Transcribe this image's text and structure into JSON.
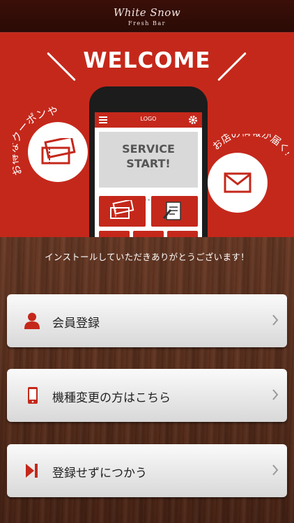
{
  "header": {
    "brand_script": "White Snow",
    "brand_sub": "Fresh Bar"
  },
  "hero": {
    "title": "WELCOME",
    "bubble_left_text": "お得なクーポンや",
    "bubble_right_text": "お店の情報が届く!",
    "phone": {
      "logo": "LOGO",
      "banner_line1": "SERVICE",
      "banner_line2": "START!"
    }
  },
  "main": {
    "thanks_text": "インストールしていただきありがとうございます！",
    "buttons": [
      {
        "label": "会員登録",
        "icon": "person-icon"
      },
      {
        "label": "機種変更の方はこちら",
        "icon": "smartphone-icon"
      },
      {
        "label": "登録せずにつかう",
        "icon": "skip-icon"
      }
    ]
  },
  "colors": {
    "accent": "#c4281b",
    "wood": "#5a2f1d"
  }
}
